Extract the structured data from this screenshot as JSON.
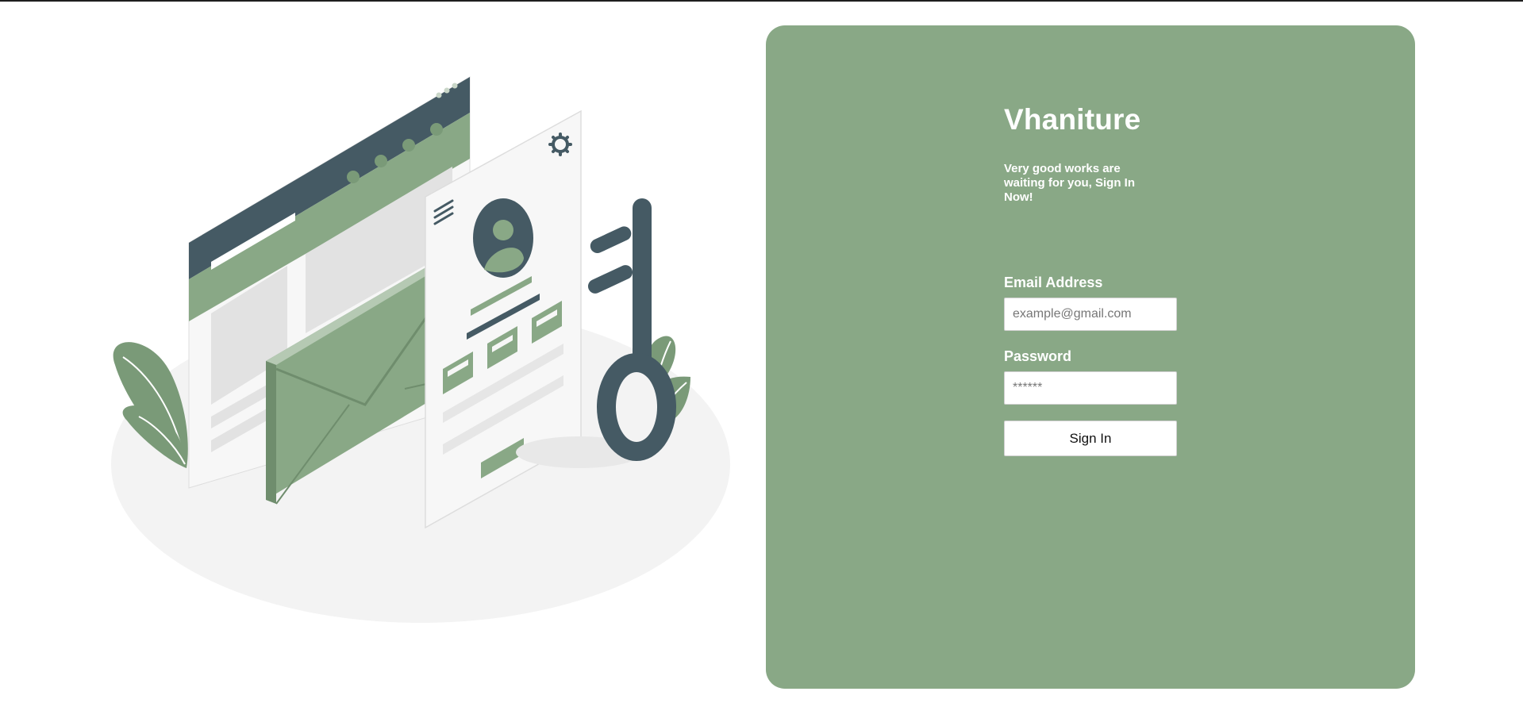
{
  "brand": "Vhaniture",
  "tagline": "Very good works are waiting for you, Sign In Now!",
  "email": {
    "label": "Email Address",
    "placeholder": "example@gmail.com",
    "value": ""
  },
  "password": {
    "label": "Password",
    "placeholder": "******",
    "value": ""
  },
  "signin_label": "Sign In",
  "colors": {
    "accent": "#89a886",
    "dark": "#455a64",
    "panel_text": "#ffffff"
  },
  "illustration": {
    "icons": [
      "browser-window-icon",
      "envelope-icon",
      "profile-card-icon",
      "gear-icon",
      "menu-icon",
      "key-icon",
      "leaf-icon"
    ]
  }
}
